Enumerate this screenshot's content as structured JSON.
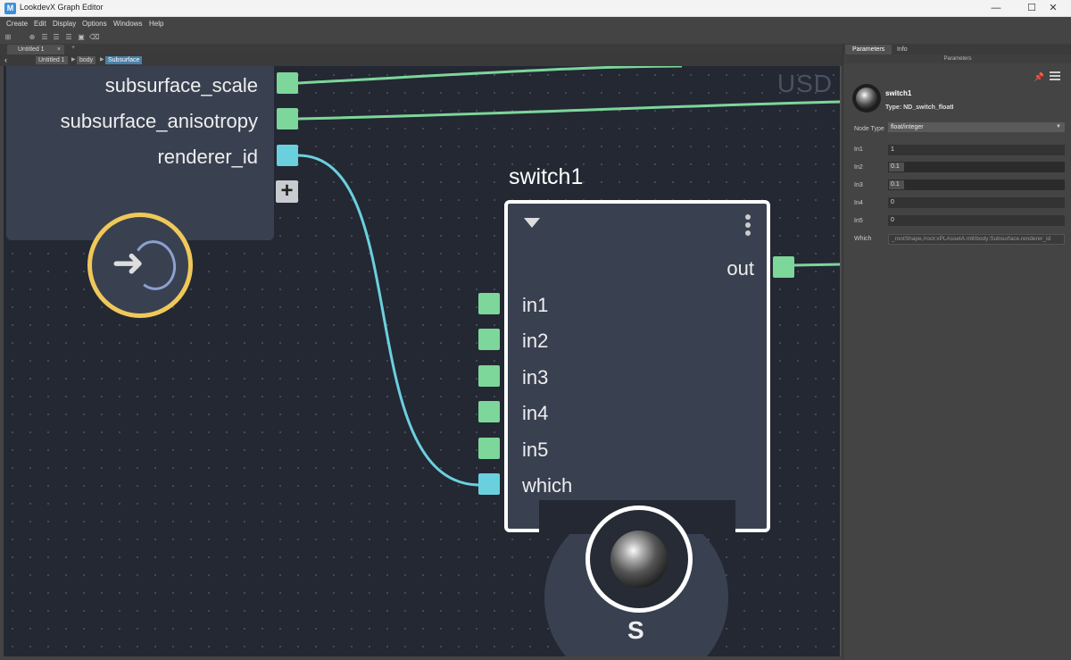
{
  "window": {
    "title": "LookdevX Graph Editor",
    "app_icon": "M"
  },
  "menubar": {
    "items": [
      "Create",
      "Edit",
      "Display",
      "Options",
      "Windows",
      "Help"
    ]
  },
  "tabs": {
    "active": "Untitled 1",
    "close": "×",
    "add": "+"
  },
  "breadcrumb": {
    "items": [
      "Untitled 1",
      "body",
      "Subsurface"
    ]
  },
  "canvas": {
    "context_label": "USD",
    "upstream_node": {
      "outputs": [
        {
          "label": "subsurface_scale",
          "color": "#7dd69a"
        },
        {
          "label": "subsurface_anisotropy",
          "color": "#7dd69a"
        },
        {
          "label": "renderer_id",
          "color": "#6bd0de"
        }
      ],
      "add_label": "+",
      "output_ring_color": "#f0c85a"
    },
    "switch_node": {
      "title": "switch1",
      "output": "out",
      "inputs": [
        "in1",
        "in2",
        "in3",
        "in4",
        "in5",
        "which"
      ],
      "badge": "S"
    }
  },
  "panel": {
    "tabs": [
      "Parameters",
      "Info"
    ],
    "section": "Parameters",
    "node_name": "switch1",
    "node_type": "Type: ND_switch_floatI",
    "node_type_label": "Node Type",
    "node_type_value": "float/integer",
    "params": [
      {
        "label": "In1",
        "value": "1"
      },
      {
        "label": "In2",
        "value": "0.1"
      },
      {
        "label": "In3",
        "value": "0.1"
      },
      {
        "label": "In4",
        "value": "0"
      },
      {
        "label": "In5",
        "value": "0"
      }
    ],
    "which_label": "Which",
    "which_value": "_rootShape,/root:xPLAssetA:mtl/body:Subsurface.renderer_id"
  },
  "colors": {
    "green_port": "#7dd69a",
    "cyan_port": "#6bd0de",
    "canvas_bg": "#232833",
    "node_bg": "#394150"
  }
}
